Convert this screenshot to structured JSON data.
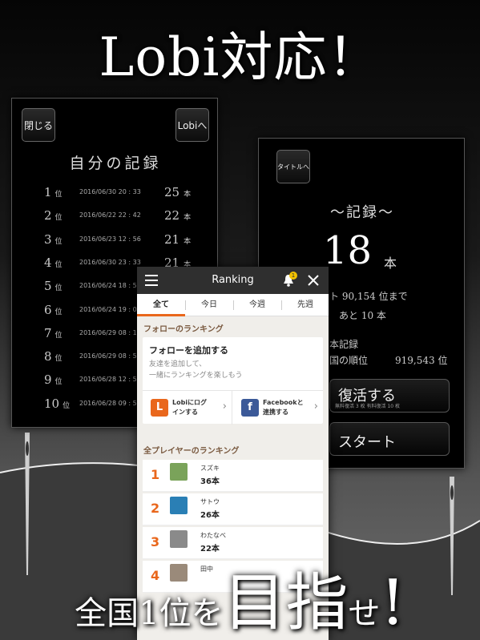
{
  "headline": "Lobi対応！",
  "left_panel": {
    "close_label": "閉じる",
    "lobi_label": "Lobiへ",
    "title": "自分の記録",
    "records": [
      {
        "rank": "1",
        "unit": "位",
        "date": "2016/06/30  20 : 33",
        "count": "25",
        "count_unit": "本"
      },
      {
        "rank": "2",
        "unit": "位",
        "date": "2016/06/22  22 : 42",
        "count": "22",
        "count_unit": "本"
      },
      {
        "rank": "3",
        "unit": "位",
        "date": "2016/06/23  12 : 56",
        "count": "21",
        "count_unit": "本"
      },
      {
        "rank": "4",
        "unit": "位",
        "date": "2016/06/30  23 : 33",
        "count": "21",
        "count_unit": "本"
      },
      {
        "rank": "5",
        "unit": "位",
        "date": "2016/06/24  18 : 5",
        "count": "",
        "count_unit": ""
      },
      {
        "rank": "6",
        "unit": "位",
        "date": "2016/06/24  19 : 0",
        "count": "",
        "count_unit": ""
      },
      {
        "rank": "7",
        "unit": "位",
        "date": "2016/06/29  08 : 1",
        "count": "",
        "count_unit": ""
      },
      {
        "rank": "8",
        "unit": "位",
        "date": "2016/06/29  08 : 5",
        "count": "",
        "count_unit": ""
      },
      {
        "rank": "9",
        "unit": "位",
        "date": "2016/06/28  12 : 5",
        "count": "",
        "count_unit": ""
      },
      {
        "rank": "10",
        "unit": "位",
        "date": "2016/06/28  09 : 5",
        "count": "",
        "count_unit": ""
      }
    ]
  },
  "right_panel": {
    "title_button": "タイトルへ",
    "subtitle": "〜記録〜",
    "score": "18",
    "score_unit": "本",
    "line1": "ト 90,154 位まで",
    "line2": "あと 10 本",
    "line3": "本記録",
    "line4_label": "国の順位",
    "line4_value": "919,543 位",
    "revive_label": "復活する",
    "revive_note": "無料復活 3 枚   有料復活 10 枚",
    "start_label": "スタート"
  },
  "ranking": {
    "header_title": "Ranking",
    "notification_count": "1",
    "tabs": [
      "全て",
      "今日",
      "今週",
      "先週"
    ],
    "follow_section_title": "フォローのランキング",
    "follow_card_title": "フォローを追加する",
    "follow_card_desc1": "友達を追加して、",
    "follow_card_desc2": "一緒にランキングを楽しもう",
    "lobi_login_label1": "Lobiにログ",
    "lobi_login_label2": "インする",
    "facebook_label1": "Facebookと",
    "facebook_label2": "連携する",
    "all_players_title": "全プレイヤーのランキング",
    "players": [
      {
        "rank": "1",
        "name": "スズキ",
        "score": "36本",
        "avatar_color": "#7aa35a"
      },
      {
        "rank": "2",
        "name": "サトウ",
        "score": "26本",
        "avatar_color": "#2a7fb5"
      },
      {
        "rank": "3",
        "name": "わたなべ",
        "score": "22本",
        "avatar_color": "#8a8a8a"
      },
      {
        "rank": "4",
        "name": "田中",
        "score": "",
        "avatar_color": "#9a8a7a"
      }
    ]
  },
  "bottom": {
    "small1": "全国",
    "small2": "1位を",
    "big1": "目指",
    "small3": "せ",
    "big2": "!"
  },
  "colors": {
    "accent": "#e9671c",
    "lobi": "#e9671c",
    "facebook": "#3b5998"
  }
}
